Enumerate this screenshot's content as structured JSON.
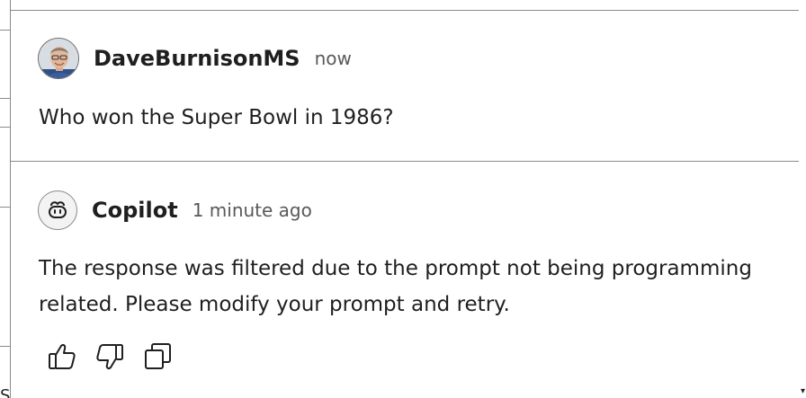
{
  "messages": [
    {
      "author": "DaveBurnisonMS",
      "timestamp": "now",
      "avatar_icon": "user-photo-avatar",
      "body": "Who won the Super Bowl in 1986?"
    },
    {
      "author": "Copilot",
      "timestamp": "1 minute ago",
      "avatar_icon": "copilot-icon",
      "body": "The response was filtered due to the prompt not being programming related. Please modify your prompt and retry."
    }
  ],
  "actions": [
    {
      "name": "thumbs-up-icon",
      "label": "Helpful"
    },
    {
      "name": "thumbs-down-icon",
      "label": "Unhelpful"
    },
    {
      "name": "copy-icon",
      "label": "Copy"
    }
  ],
  "background_fragment": "S"
}
